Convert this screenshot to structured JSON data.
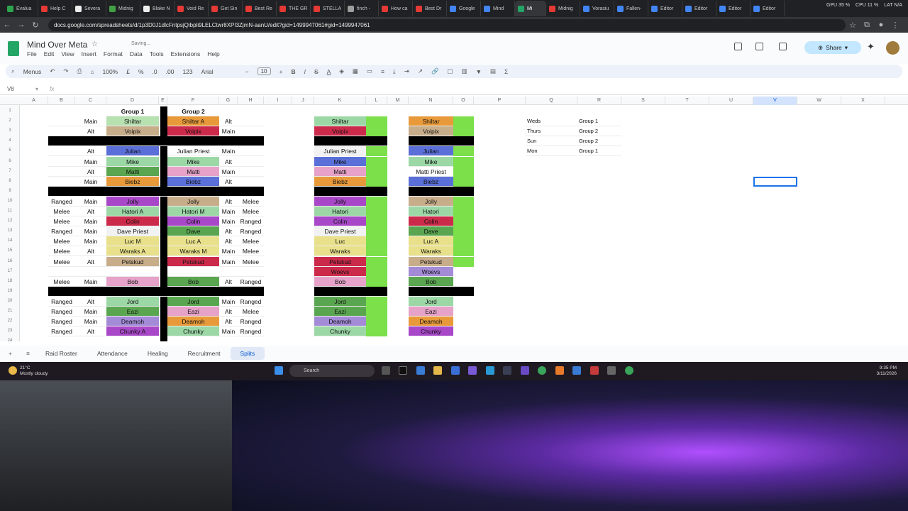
{
  "browser": {
    "tabs": [
      "Evalua",
      "Help C",
      "Severa",
      "Midnig",
      "Blake N",
      "Void Re",
      "Get Sin",
      "Best Re",
      "THE GR",
      "STELLA",
      "finch -",
      "How ca",
      "Best Dr",
      "Google",
      "Mind",
      "Mi",
      "Midnig",
      "Vorasiu",
      "Fallen-",
      "Editor",
      "Editor",
      "Editor",
      "Editor"
    ],
    "active_tab_index": 15,
    "url": "docs.google.com/spreadsheets/d/1p3D0J1dlcFntpsjQibpli9LELCtwr8XPI3ZjmN-aanU/edit?gid=1499947061#gid=1499947061",
    "overlay_stats": [
      "GPU 35 %",
      "CPU 11 %",
      "LAT N/A"
    ]
  },
  "sheets": {
    "doc_title": "Mind Over Meta",
    "status": "Saving...",
    "menu": [
      "File",
      "Edit",
      "View",
      "Insert",
      "Format",
      "Data",
      "Tools",
      "Extensions",
      "Help"
    ],
    "share_label": "Share",
    "toolbar": {
      "menus": "Menus",
      "zoom": "100%",
      "currency": "£",
      "percent": "%",
      "dec1": ".0",
      "dec2": ".00",
      "fmt": "123",
      "font": "Arial",
      "size": "10"
    },
    "cell_ref": "V8",
    "columns": [
      "A",
      "B",
      "C",
      "D",
      "E",
      "F",
      "G",
      "H",
      "I",
      "J",
      "K",
      "L",
      "M",
      "N",
      "O",
      "P",
      "Q",
      "R",
      "S",
      "T",
      "U",
      "V",
      "W",
      "X"
    ],
    "selected_column": "V",
    "rows": [
      "1",
      "2",
      "3",
      "4",
      "5",
      "6",
      "7",
      "8",
      "9",
      "10",
      "11",
      "12",
      "13",
      "14",
      "15",
      "16",
      "17",
      "18",
      "19",
      "20",
      "21",
      "22",
      "23",
      "24"
    ],
    "sheet_tabs": [
      "Raid Roster",
      "Attendance",
      "Healing",
      "Recruitment",
      "Splits"
    ],
    "active_sheet": "Splits",
    "headers": {
      "group1": "Group 1",
      "group2": "Group 2"
    },
    "g1": [
      [
        "",
        "Main",
        "Shiltar",
        "#b7e1b0",
        "Shiltar A",
        "#e89a3a",
        "Alt",
        ""
      ],
      [
        "",
        "Alt",
        "Voipix",
        "#c8ad8a",
        "Voipix",
        "#cc2a4a",
        "Main",
        ""
      ],
      null,
      [
        "",
        "Alt",
        "Julian",
        "#5a6fd8",
        "Julian Priest",
        "#ffffff",
        "Main",
        ""
      ],
      [
        "",
        "Main",
        "Mike",
        "#9bd8a6",
        "Mike",
        "#9bd8a6",
        "Alt",
        ""
      ],
      [
        "",
        "Alt",
        "Matti",
        "#5aa650",
        "Matti",
        "#e6a2c8",
        "Main",
        ""
      ],
      [
        "",
        "Main",
        "Biebz",
        "#e89a3a",
        "Biebz",
        "#5a6fd8",
        "Alt",
        ""
      ],
      null,
      [
        "Ranged",
        "Main",
        "Jolly",
        "#a848c8",
        "Jolly",
        "#c8ad8a",
        "Alt",
        "Melee"
      ],
      [
        "Melee",
        "Alt",
        "Hatori A",
        "#9bd8a6",
        "Hatori M",
        "#9bd8a6",
        "Main",
        "Melee"
      ],
      [
        "Melee",
        "Main",
        "Colin",
        "#cc2a4a",
        "Colin",
        "#a848c8",
        "Main",
        "Ranged"
      ],
      [
        "Ranged",
        "Main",
        "Dave Priest",
        "#f2f2f2",
        "Dave",
        "#5aa650",
        "Alt",
        "Ranged"
      ],
      [
        "Melee",
        "Main",
        "Luc M",
        "#e8e08a",
        "Luc A",
        "#e8e08a",
        "Alt",
        "Melee"
      ],
      [
        "Melee",
        "Alt",
        "Waraks A",
        "#e8e08a",
        "Waraks M",
        "#e8e08a",
        "Main",
        "Melee"
      ],
      [
        "Melee",
        "Alt",
        "Petskud",
        "#c8ad8a",
        "Petskud",
        "#cc2a4a",
        "Main",
        "Melee"
      ],
      [
        "",
        "",
        "",
        "#ffffff",
        "",
        "#ffffff",
        "",
        ""
      ],
      [
        "Melee",
        "Main",
        "Bob",
        "#e6a2c8",
        "Bob",
        "#5aa650",
        "Alt",
        "Ranged"
      ],
      null,
      [
        "Ranged",
        "Alt",
        "Jord",
        "#9bd8a6",
        "Jord",
        "#5aa650",
        "Main",
        "Ranged"
      ],
      [
        "Ranged",
        "Main",
        "Eazi",
        "#5aa650",
        "Eazi",
        "#e6a2c8",
        "Alt",
        "Melee"
      ],
      [
        "Ranged",
        "Main",
        "Deamoh",
        "#a38bd8",
        "Deamoh",
        "#e89a3a",
        "Alt",
        "Ranged"
      ],
      [
        "Ranged",
        "Alt",
        "Chunky A",
        "#a848c8",
        "Chunky",
        "#9bd8a6",
        "Main",
        "Ranged"
      ]
    ],
    "colK": [
      [
        "Shiltar",
        "#9bd8a6"
      ],
      [
        "Voipix",
        "#cc2a4a"
      ],
      null,
      [
        "Julian Priest",
        "#f2f2f2"
      ],
      [
        "Mike",
        "#5a6fd8"
      ],
      [
        "Matti",
        "#e6a2c8"
      ],
      [
        "Biebz",
        "#e89a3a"
      ],
      null,
      [
        "Jolly",
        "#a848c8"
      ],
      [
        "Hatori",
        "#9bd8a6"
      ],
      [
        "Colin",
        "#a848c8"
      ],
      [
        "Dave Priest",
        "#f2f2f2"
      ],
      [
        "Luc",
        "#e8e08a"
      ],
      [
        "Waraks",
        "#e8e08a"
      ],
      [
        "Petskud",
        "#cc2a4a"
      ],
      [
        "Woevs",
        "#cc2a4a"
      ],
      [
        "Bob",
        "#e6a2c8"
      ],
      null,
      [
        "Jord",
        "#5aa650"
      ],
      [
        "Eazi",
        "#5aa650"
      ],
      [
        "Deamoh",
        "#a38bd8"
      ],
      [
        "Chunky",
        "#9bd8a6"
      ]
    ],
    "colN": [
      [
        "Shiltar",
        "#e89a3a"
      ],
      [
        "Voipix",
        "#c8ad8a"
      ],
      null,
      [
        "Julian",
        "#5a6fd8"
      ],
      [
        "Mike",
        "#9bd8a6"
      ],
      [
        "Matti Priest",
        "#ffffff"
      ],
      [
        "Biebz",
        "#5a6fd8"
      ],
      null,
      [
        "Jolly",
        "#c8ad8a"
      ],
      [
        "Hatori",
        "#9bd8a6"
      ],
      [
        "Colin",
        "#cc2a4a"
      ],
      [
        "Dave",
        "#5aa650"
      ],
      [
        "Luc A",
        "#e8e08a"
      ],
      [
        "Waraks",
        "#e8e08a"
      ],
      [
        "Petskud",
        "#c8ad8a"
      ],
      [
        "Woevs",
        "#a38bd8"
      ],
      [
        "Bob",
        "#5aa650"
      ],
      null,
      [
        "Jord",
        "#9bd8a6"
      ],
      [
        "Eazi",
        "#e6a2c8"
      ],
      [
        "Deamoh",
        "#e89a3a"
      ],
      [
        "Chunky",
        "#a848c8"
      ]
    ],
    "schedule": [
      [
        "Weds",
        "Group 1"
      ],
      [
        "Thurs",
        "Group 2"
      ],
      [
        "Sun",
        "Group 2"
      ],
      [
        "Mon",
        "Group 1"
      ]
    ]
  },
  "taskbar": {
    "weather_temp": "21°C",
    "weather_desc": "Mostly cloudy",
    "search": "Search",
    "time": "9:35 PM",
    "date": "3/11/2026"
  }
}
